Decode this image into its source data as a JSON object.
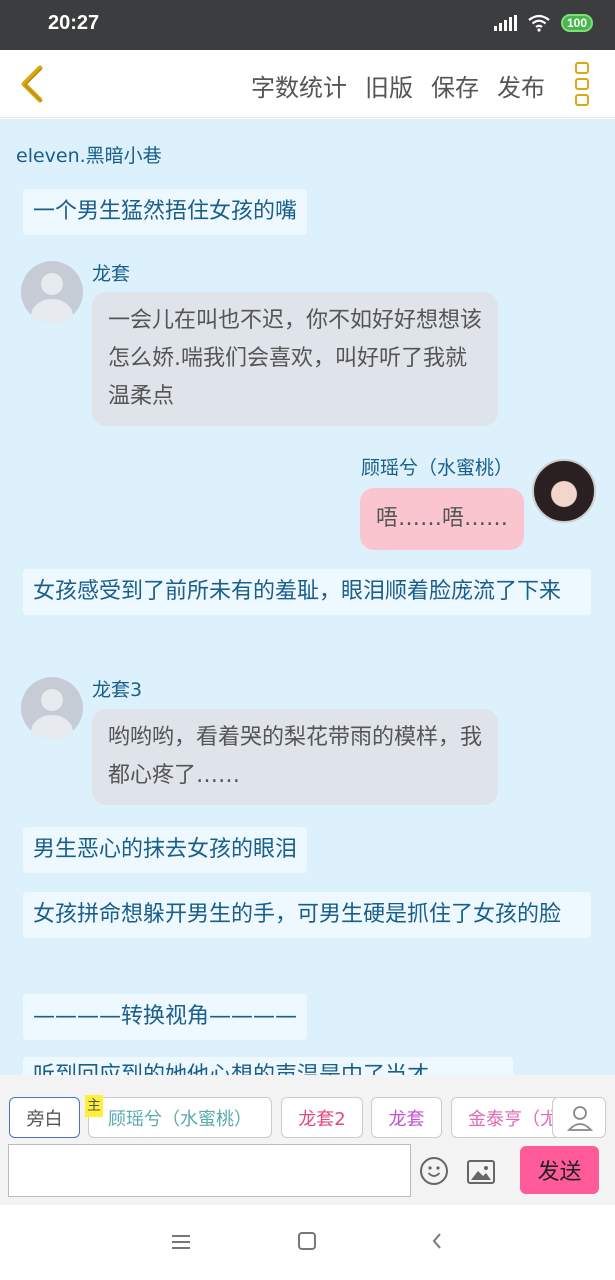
{
  "status": {
    "time": "20:27",
    "battery": "100"
  },
  "toolbar": {
    "word_count": "字数统计",
    "old_version": "旧版",
    "save": "保存",
    "publish": "发布"
  },
  "chat": {
    "narrator_name": "eleven.黑暗小巷",
    "n1": "一个男生猛然捂住女孩的嘴",
    "m1_name": "龙套",
    "m1_text": "一会儿在叫也不迟，你不如好好想想该怎么娇.喘我们会喜欢，叫好听了我就温柔点",
    "m2_name": "顾瑶兮（水蜜桃）",
    "m2_text": "唔……唔……",
    "n2": "女孩感受到了前所未有的羞耻，眼泪顺着脸庞流了下来",
    "m3_name": "龙套3",
    "m3_text": "哟哟哟，看着哭的梨花带雨的模样，我都心疼了……",
    "n3": "男生恶心的抹去女孩的眼泪",
    "n4": "女孩拼命想躲开男生的手，可男生硬是抓住了女孩的脸",
    "n5": "————转换视角————",
    "n6": "听到回应到的她他心想的声温是中了当才"
  },
  "roles": {
    "narrator": "旁白",
    "master_badge": "主",
    "r1": "顾瑶兮（水蜜桃）",
    "r2": "龙套2",
    "r3": "龙套",
    "r4": "金泰亨（尤"
  },
  "composer": {
    "input_value": "",
    "send": "发送"
  },
  "colors": {
    "accent_yellow": "#d9a915",
    "send_pink": "#ff5b9a",
    "chat_bg": "#dcf1fc",
    "narration_text": "#1a5f8c"
  }
}
